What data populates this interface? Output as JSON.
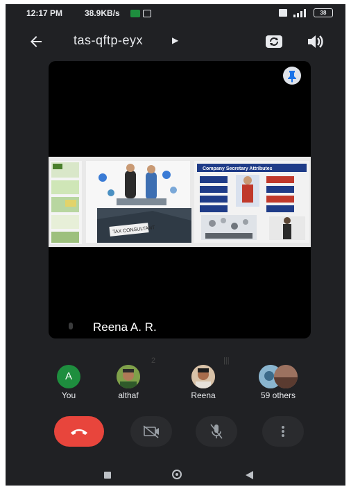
{
  "status_bar": {
    "time": "12:17 PM",
    "network_speed": "38.9KB/s",
    "battery": "38"
  },
  "app_bar": {
    "meeting_code": "tas-qftp-eyx",
    "back_icon": "arrow-left-icon",
    "switch_camera_icon": "switch-camera-icon",
    "speaker_icon": "volume-icon"
  },
  "main_tile": {
    "speaker_name": "Reena A. R.",
    "presentation": {
      "slide_title": "Company Secretary Attributes",
      "caption": "TAX CONSULTANT"
    }
  },
  "participants": [
    {
      "name": "You",
      "avatar_letter": "A",
      "avatar_color": "#1e8e3e"
    },
    {
      "name": "althaf",
      "avatar_color": "#6b8c3a"
    },
    {
      "name": "Reena",
      "avatar_color": "#b07a58"
    },
    {
      "name": "59 others",
      "avatar_color": "#6fa0bf"
    }
  ],
  "controls": {
    "end_call_icon": "end-call-icon",
    "camera_icon": "camera-off-icon",
    "mic_icon": "mic-off-icon",
    "more_icon": "more-vert-icon"
  },
  "colors": {
    "background": "#202124",
    "end_call": "#e8453c",
    "control": "#2a2b2e",
    "text": "#e8eaed"
  }
}
